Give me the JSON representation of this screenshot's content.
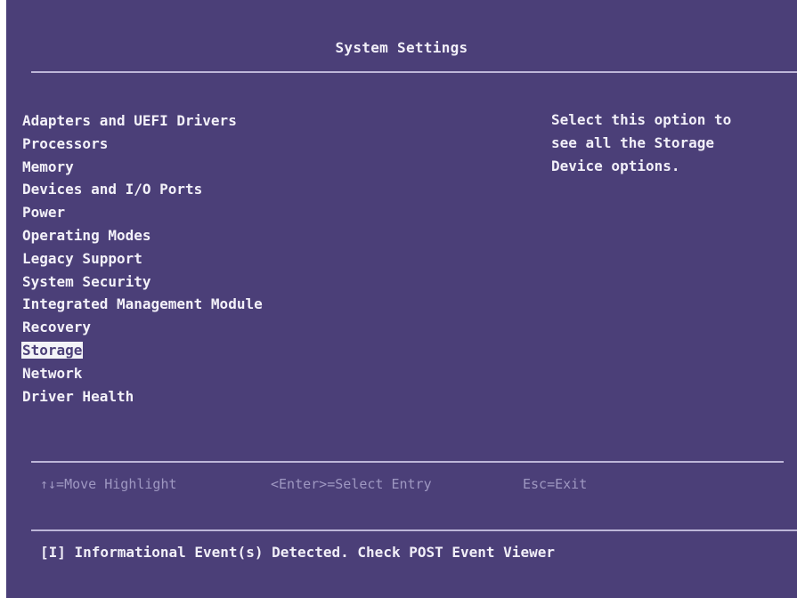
{
  "header": {
    "title": "System Settings"
  },
  "menu": {
    "items": [
      {
        "label": "Adapters and UEFI Drivers"
      },
      {
        "label": "Processors"
      },
      {
        "label": "Memory"
      },
      {
        "label": "Devices and I/O Ports"
      },
      {
        "label": "Power"
      },
      {
        "label": "Operating Modes"
      },
      {
        "label": "Legacy Support"
      },
      {
        "label": "System Security"
      },
      {
        "label": "Integrated Management Module"
      },
      {
        "label": "Recovery"
      },
      {
        "label": "Storage",
        "selected": true
      },
      {
        "label": "Network"
      },
      {
        "label": "Driver Health"
      }
    ]
  },
  "help": {
    "text": "Select this option to\nsee all the Storage\nDevice options."
  },
  "keys": {
    "move": "↑↓=Move Highlight",
    "enter": "<Enter>=Select Entry",
    "esc": "Esc=Exit"
  },
  "status": {
    "message": "[I] Informational Event(s) Detected. Check POST Event Viewer"
  },
  "colors": {
    "background": "#4b3f78",
    "text": "#f1eff8",
    "highlight_bg": "#f3f3f7",
    "dim_text": "#9f98c2"
  }
}
